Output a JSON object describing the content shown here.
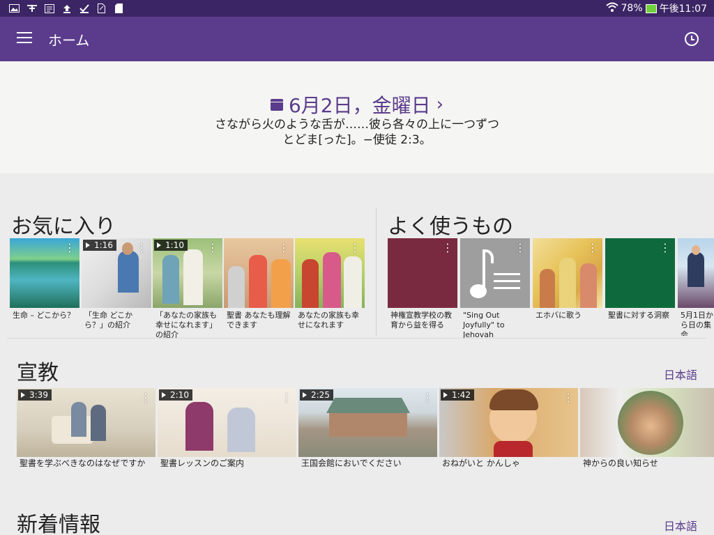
{
  "status": {
    "battery": "78%",
    "time": "午後11:07",
    "icons": [
      "image-icon",
      "translate-icon",
      "reader-icon",
      "upload-icon",
      "check-icon",
      "sim-icon",
      "sdcard-icon"
    ]
  },
  "appbar": {
    "title": "ホーム"
  },
  "daily": {
    "date": "6月2日，金曜日",
    "chevron": "›",
    "line1": "さながら火のような舌が……彼ら各々の上に一つずつ",
    "line2": "とどま[った]。−使徒 2:3。"
  },
  "favorites": {
    "title": "お気に入り",
    "items": [
      {
        "caption": "生命 – どこから？",
        "duration": ""
      },
      {
        "caption": "「生命 どこから？」の紹介",
        "duration": "1:16"
      },
      {
        "caption": "「あなたの家族も幸せになれます」の紹介",
        "duration": "1:10"
      },
      {
        "caption": "聖書 あなたも理解できます",
        "duration": ""
      },
      {
        "caption": "あなたの家族も幸せになれます",
        "duration": ""
      }
    ]
  },
  "frequent": {
    "title": "よく使うもの",
    "items": [
      {
        "caption": "神権宣教学校の教育から益を得る"
      },
      {
        "caption": "\"Sing Out Joyfully\" to Jehovah"
      },
      {
        "caption": "エホバに歌う"
      },
      {
        "caption": "聖書に対する洞察"
      },
      {
        "caption": "5月1日から日の集会"
      }
    ]
  },
  "ministry": {
    "title": "宣教",
    "language": "日本語",
    "items": [
      {
        "caption": "聖書を学ぶべきなのはなぜですか",
        "duration": "3:39"
      },
      {
        "caption": "聖書レッスンのご案内",
        "duration": "2:10"
      },
      {
        "caption": "王国会館においでください",
        "duration": "2:25"
      },
      {
        "caption": "おねがいと かんしゃ",
        "duration": "1:42"
      },
      {
        "caption": "神からの良い知らせ",
        "duration": ""
      }
    ]
  },
  "whatsnew": {
    "title": "新着情報",
    "language": "日本語"
  },
  "colors": {
    "statusbar": "#3c2565",
    "appbar": "#5b3c8c",
    "accent": "#5b3c8c",
    "maroon_tile": "#7a2a40",
    "gray_tile": "#9e9e9e",
    "green_tile": "#0e6a3c"
  }
}
